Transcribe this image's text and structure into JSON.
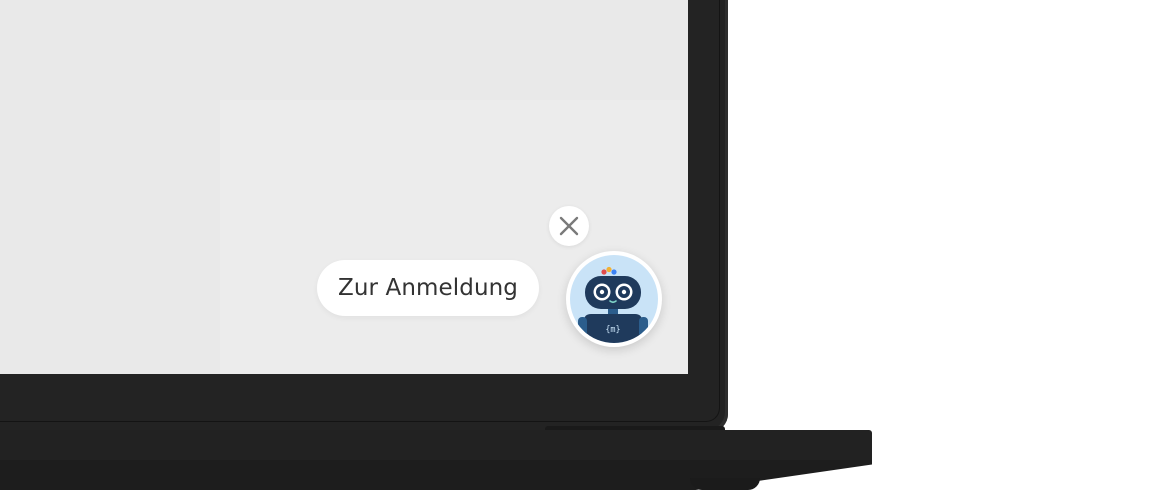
{
  "chat_widget": {
    "prompt_label": "Zur Anmeldung",
    "close_icon": "close-icon",
    "avatar_icon": "robot-avatar-icon",
    "avatar_badge": "{m}"
  },
  "colors": {
    "screen_background": "#e9e9e9",
    "laptop_body": "#232323",
    "bubble_background": "#ffffff",
    "bubble_text": "#333333",
    "avatar_background": "#c9e3f7",
    "robot_body": "#1f3a5c",
    "robot_dots": [
      "#e04b4b",
      "#f2b134",
      "#3b82f6"
    ]
  }
}
